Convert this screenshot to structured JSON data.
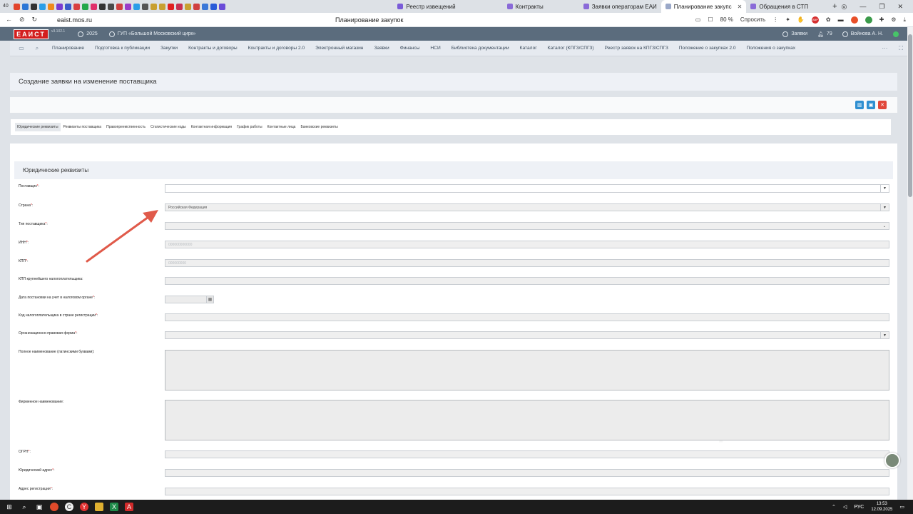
{
  "browser": {
    "left_favicon_count": "40",
    "tabs": [
      {
        "label": "Реестр извещений",
        "active": false
      },
      {
        "label": "Контракты",
        "active": false
      },
      {
        "label": "Заявки операторам ЕАИ",
        "active": false
      },
      {
        "label": "Планирование закупс",
        "active": true
      },
      {
        "label": "Обращения в СТП",
        "active": false
      }
    ],
    "url": "eaist.mos.ru",
    "page_title": "Планирование закупок",
    "zoom": "80 %",
    "ask_label": "Спросить",
    "badge": "ABP"
  },
  "app": {
    "logo": "ЕАИСТ",
    "version": "v3.102.1",
    "year": "2025",
    "organization": "ГУП «Большой Московский цирк»",
    "requests_label": "Заявки",
    "notifications_count": "79",
    "user_name": "Войнова А. Н."
  },
  "menu": {
    "items": [
      "Планирование",
      "Подготовка к публикации",
      "Закупки",
      "Контракты и договоры",
      "Контракты и договоры 2.0",
      "Электронный магазин",
      "Заявки",
      "Финансы",
      "НСИ",
      "Библиотека документации",
      "Каталог",
      "Каталог (КПГЗ/СПГЗ)",
      "Реестр заявок на КПГЗ/СПГЗ",
      "Положение о закупках 2.0",
      "Положения о закупках"
    ]
  },
  "page": {
    "title": "Создание заявки на изменение поставщика",
    "form_tabs": [
      "Юридические реквизиты",
      "Реквизиты поставщика",
      "Правопреемственность",
      "Статистические коды",
      "Контактная информация",
      "График работы",
      "Контактные лица",
      "Банковские реквизиты"
    ],
    "section_title": "Юридические реквизиты"
  },
  "form": {
    "supplier": {
      "label": "Поставщик",
      "value": ""
    },
    "country": {
      "label": "Страна",
      "value": "Российская Федерация"
    },
    "supplier_type": {
      "label": "Тип поставщика",
      "value": ""
    },
    "inn": {
      "label": "ИНН",
      "placeholder": "000000000000"
    },
    "kpp": {
      "label": "КПП",
      "placeholder": "000000000"
    },
    "kpp_largest": {
      "label": "КПП крупнейшего налогоплательщика",
      "value": ""
    },
    "tax_date": {
      "label": "Дата постановки на учет в налоговом органе",
      "value": ""
    },
    "taxpayer_code": {
      "label": "Код налогоплательщика в стране регистрации",
      "value": ""
    },
    "legal_form": {
      "label": "Организационно-правовая форма",
      "value": ""
    },
    "full_name_latin": {
      "label": "Полное наименование (латинскими буквами)",
      "value": ""
    },
    "brand_name": {
      "label": "Фирменное наименование",
      "value": ""
    },
    "ogrn": {
      "label": "ОГРН",
      "value": ""
    },
    "legal_address": {
      "label": "Юридический адрес",
      "value": ""
    },
    "registration_address": {
      "label": "Адрес регистрации",
      "value": ""
    }
  },
  "taskbar": {
    "language": "РУС",
    "time": "13:53",
    "date": "12.09.2025"
  }
}
